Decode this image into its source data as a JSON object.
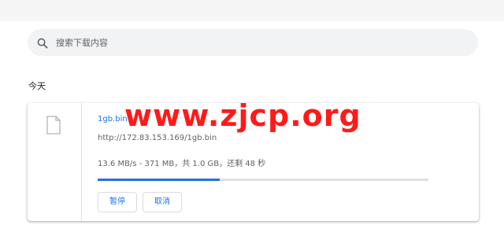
{
  "search": {
    "placeholder": "搜索下载内容"
  },
  "section": {
    "date_label": "今天"
  },
  "download": {
    "file_name": "1gb.bin",
    "url": "http://172.83.153.169/1gb.bin",
    "status_text": "13.6 MB/s - 371 MB，共 1.0 GB，还剩 48 秒",
    "progress_fraction": 0.37,
    "pause_label": "暂停",
    "cancel_label": "取消"
  },
  "watermark": {
    "text": "www.zjcp.org"
  },
  "colors": {
    "accent": "#1a73e8",
    "watermark": "#ff1a1a",
    "track": "#e0e0e0"
  },
  "icons": {
    "search": "search-icon",
    "file": "file-icon"
  }
}
